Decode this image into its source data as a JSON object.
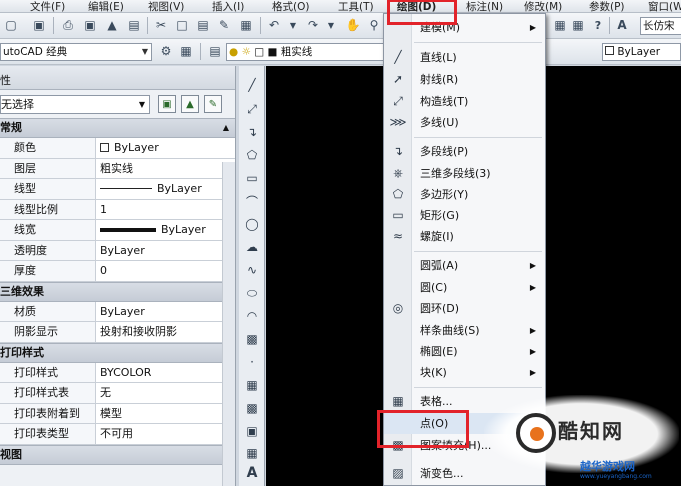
{
  "menubar": {
    "items": [
      "文件(F)",
      "编辑(E)",
      "视图(V)",
      "插入(I)",
      "格式(O)",
      "工具(T)",
      "绘图(D)",
      "标注(N)",
      "修改(M)",
      "参数(P)",
      "窗口(W)"
    ]
  },
  "toolbar": {
    "workspace": "utoCAD 经典",
    "layer": "粗实线",
    "style": "长仿宋",
    "bylayer": "ByLayer"
  },
  "properties": {
    "title": "性",
    "selection": "无选择",
    "sections": [
      {
        "title": "常规",
        "rows": [
          {
            "key": "颜色",
            "value": "ByLayer",
            "mark": "square"
          },
          {
            "key": "图层",
            "value": "粗实线",
            "mark": ""
          },
          {
            "key": "线型",
            "value": "ByLayer",
            "mark": "thin"
          },
          {
            "key": "线型比例",
            "value": "1",
            "mark": ""
          },
          {
            "key": "线宽",
            "value": "ByLayer",
            "mark": "thick"
          },
          {
            "key": "透明度",
            "value": "ByLayer",
            "mark": ""
          },
          {
            "key": "厚度",
            "value": "0",
            "mark": ""
          }
        ]
      },
      {
        "title": "三维效果",
        "rows": [
          {
            "key": "材质",
            "value": "ByLayer",
            "mark": ""
          },
          {
            "key": "阴影显示",
            "value": "投射和接收阴影",
            "mark": ""
          }
        ]
      },
      {
        "title": "打印样式",
        "rows": [
          {
            "key": "打印样式",
            "value": "BYCOLOR",
            "mark": ""
          },
          {
            "key": "打印样式表",
            "value": "无",
            "mark": ""
          },
          {
            "key": "打印表附着到",
            "value": "模型",
            "mark": ""
          },
          {
            "key": "打印表类型",
            "value": "不可用",
            "mark": ""
          }
        ]
      },
      {
        "title": "视图",
        "rows": []
      }
    ]
  },
  "draw_menu": {
    "items": [
      {
        "label": "建模(M)",
        "icon": "none",
        "submenu": true
      },
      {
        "label": "直线(L)",
        "icon": "line-icon",
        "submenu": false
      },
      {
        "label": "射线(R)",
        "icon": "ray-icon",
        "submenu": false
      },
      {
        "label": "构造线(T)",
        "icon": "xline-icon",
        "submenu": false
      },
      {
        "label": "多线(U)",
        "icon": "mline-icon",
        "submenu": false
      },
      {
        "label": "多段线(P)",
        "icon": "polyline-icon",
        "submenu": false
      },
      {
        "label": "三维多段线(3)",
        "icon": "3dpoly-icon",
        "submenu": false
      },
      {
        "label": "多边形(Y)",
        "icon": "polygon-icon",
        "submenu": false
      },
      {
        "label": "矩形(G)",
        "icon": "rectangle-icon",
        "submenu": false
      },
      {
        "label": "螺旋(I)",
        "icon": "helix-icon",
        "submenu": false
      },
      {
        "label": "圆弧(A)",
        "icon": "none",
        "submenu": true
      },
      {
        "label": "圆(C)",
        "icon": "none",
        "submenu": true
      },
      {
        "label": "圆环(D)",
        "icon": "donut-icon",
        "submenu": false
      },
      {
        "label": "样条曲线(S)",
        "icon": "none",
        "submenu": true
      },
      {
        "label": "椭圆(E)",
        "icon": "none",
        "submenu": true
      },
      {
        "label": "块(K)",
        "icon": "none",
        "submenu": true
      },
      {
        "label": "表格...",
        "icon": "table-icon",
        "submenu": false
      },
      {
        "label": "点(O)",
        "icon": "point-icon",
        "submenu": true
      },
      {
        "label": "图案填充(H)...",
        "icon": "hatch-icon",
        "submenu": false
      },
      {
        "label": "渐变色...",
        "icon": "gradient-icon",
        "submenu": false
      }
    ]
  },
  "watermark": {
    "name": "酷知网",
    "site": "越华游戏网",
    "url": "www.yueyangbang.com"
  },
  "colors": {
    "highlight": "#e2232a",
    "canvas": "#000000",
    "accent": "#e8721c"
  }
}
